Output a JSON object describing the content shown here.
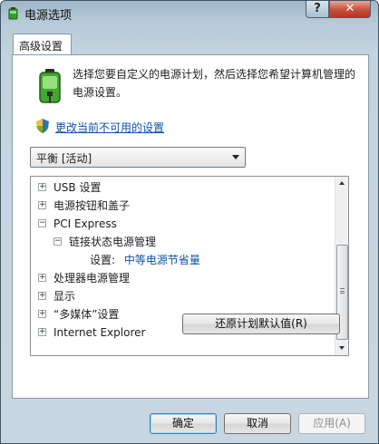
{
  "window": {
    "title": "电源选项",
    "help_label": "?",
    "close_label": "✕"
  },
  "tab": {
    "label": "高级设置"
  },
  "content": {
    "description": "选择您要自定义的电源计划，然后选择您希望计算机管理的电源设置。",
    "change_link": "更改当前不可用的设置"
  },
  "plan_select": {
    "value": "平衡 [活动]"
  },
  "tree": {
    "items": [
      {
        "expander": "+",
        "label": "USB 设置"
      },
      {
        "expander": "+",
        "label": "电源按钮和盖子"
      },
      {
        "expander": "−",
        "label": "PCI Express"
      },
      {
        "expander": "−",
        "label": "链接状态电源管理"
      },
      {
        "expander": "",
        "label": "设置:",
        "value": "中等电源节省量"
      },
      {
        "expander": "+",
        "label": "处理器电源管理"
      },
      {
        "expander": "+",
        "label": "显示"
      },
      {
        "expander": "+",
        "label": "“多媒体”设置"
      },
      {
        "expander": "+",
        "label": "Internet Explorer"
      }
    ]
  },
  "buttons": {
    "restore": "还原计划默认值(R)",
    "ok": "确定",
    "cancel": "取消",
    "apply": "应用(A)"
  },
  "colors": {
    "link": "#0b53a8",
    "accent": "#3c7fb1"
  },
  "icons": [
    "power-options-icon",
    "battery-plug-icon",
    "uac-shield-icon"
  ]
}
